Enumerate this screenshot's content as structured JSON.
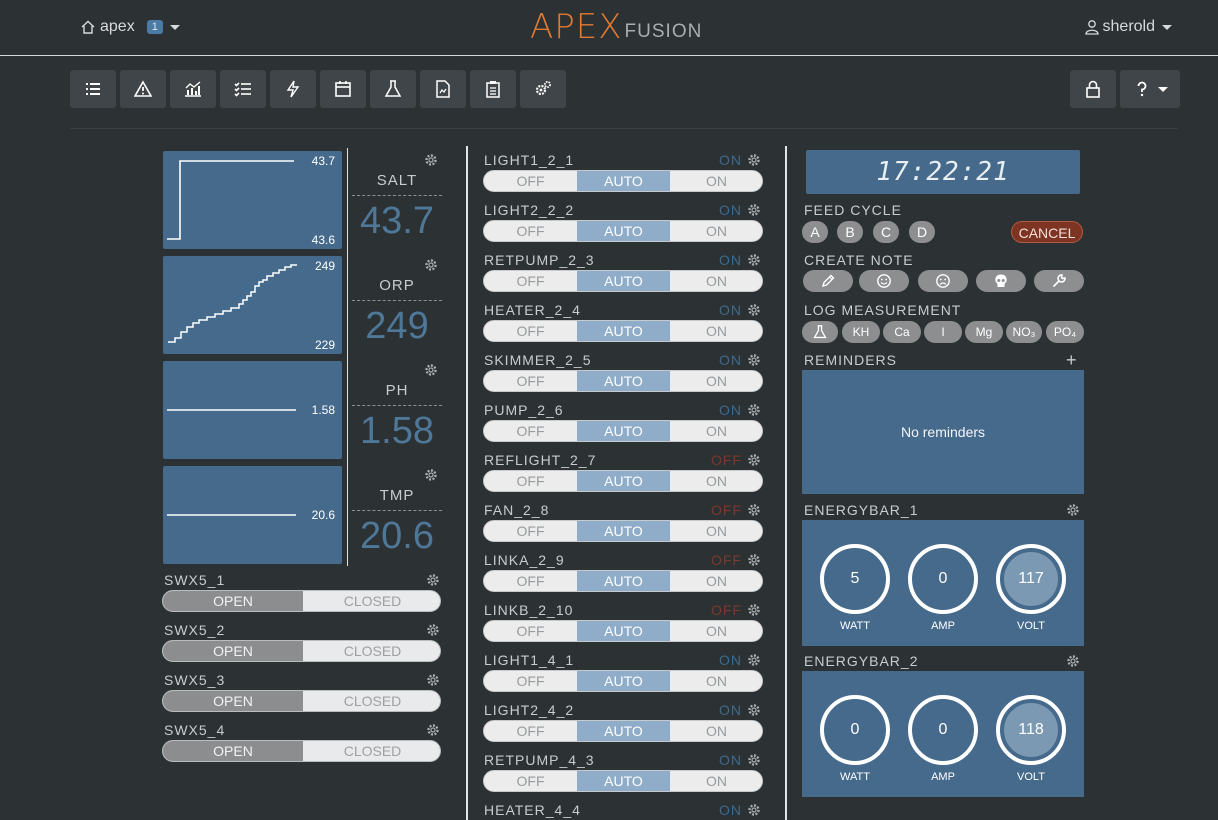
{
  "header": {
    "home_label": "apex",
    "badge": "1",
    "logo_main": "APEX",
    "logo_sub": "FUSION",
    "user": "sherold"
  },
  "toolbar": {
    "icons": [
      "list-icon",
      "alert-icon",
      "chart-icon",
      "checklist-icon",
      "power-icon",
      "calendar-icon",
      "flask-icon",
      "document-icon",
      "clipboard-icon",
      "gears-icon"
    ],
    "right_icons": [
      "lock-icon",
      "help-icon"
    ]
  },
  "probes": [
    {
      "name": "SALT",
      "value": "43.7",
      "hi": "43.7",
      "lo": "43.6"
    },
    {
      "name": "ORP",
      "value": "249",
      "hi": "249",
      "lo": "229"
    },
    {
      "name": "PH",
      "value": "1.58",
      "mid": "1.58"
    },
    {
      "name": "TMP",
      "value": "20.6",
      "mid": "20.6"
    }
  ],
  "switches": [
    {
      "name": "SWX5_1",
      "open": "OPEN",
      "closed": "CLOSED"
    },
    {
      "name": "SWX5_2",
      "open": "OPEN",
      "closed": "CLOSED"
    },
    {
      "name": "SWX5_3",
      "open": "OPEN",
      "closed": "CLOSED"
    },
    {
      "name": "SWX5_4",
      "open": "OPEN",
      "closed": "CLOSED"
    }
  ],
  "toggle_labels": {
    "off": "OFF",
    "auto": "AUTO",
    "on": "ON"
  },
  "outlets": [
    {
      "name": "LIGHT1_2_1",
      "state": "ON"
    },
    {
      "name": "LIGHT2_2_2",
      "state": "ON"
    },
    {
      "name": "RETPUMP_2_3",
      "state": "ON"
    },
    {
      "name": "HEATER_2_4",
      "state": "ON"
    },
    {
      "name": "SKIMMER_2_5",
      "state": "ON"
    },
    {
      "name": "PUMP_2_6",
      "state": "ON"
    },
    {
      "name": "REFLIGHT_2_7",
      "state": "OFF"
    },
    {
      "name": "FAN_2_8",
      "state": "OFF"
    },
    {
      "name": "LINKA_2_9",
      "state": "OFF"
    },
    {
      "name": "LINKB_2_10",
      "state": "OFF"
    },
    {
      "name": "LIGHT1_4_1",
      "state": "ON"
    },
    {
      "name": "LIGHT2_4_2",
      "state": "ON"
    },
    {
      "name": "RETPUMP_4_3",
      "state": "ON"
    },
    {
      "name": "HEATER_4_4",
      "state": "ON"
    }
  ],
  "clock": "17:22:21",
  "feed_cycle": {
    "label": "FEED CYCLE",
    "buttons": [
      "A",
      "B",
      "C",
      "D"
    ],
    "cancel": "CANCEL"
  },
  "create_note": {
    "label": "CREATE NOTE",
    "icons": [
      "pencil-icon",
      "smile-icon",
      "frown-icon",
      "skull-icon",
      "wrench-icon"
    ]
  },
  "log_measurement": {
    "label": "LOG MEASUREMENT",
    "buttons": [
      "flask",
      "KH",
      "Ca",
      "I",
      "Mg",
      "NO₃",
      "PO₄"
    ]
  },
  "reminders": {
    "label": "REMINDERS",
    "empty": "No reminders"
  },
  "energybars": [
    {
      "name": "ENERGYBAR_1",
      "watt": "5",
      "amp": "0",
      "volt": "117",
      "watt_label": "WATT",
      "amp_label": "AMP",
      "volt_label": "VOLT"
    },
    {
      "name": "ENERGYBAR_2",
      "watt": "0",
      "amp": "0",
      "volt": "118",
      "watt_label": "WATT",
      "amp_label": "AMP",
      "volt_label": "VOLT"
    }
  ],
  "colors": {
    "accent": "#e07a32",
    "panel": "#456a8b",
    "on": "#3e6a8c",
    "off": "#7a3a2c",
    "cancel": "#7d3423"
  }
}
